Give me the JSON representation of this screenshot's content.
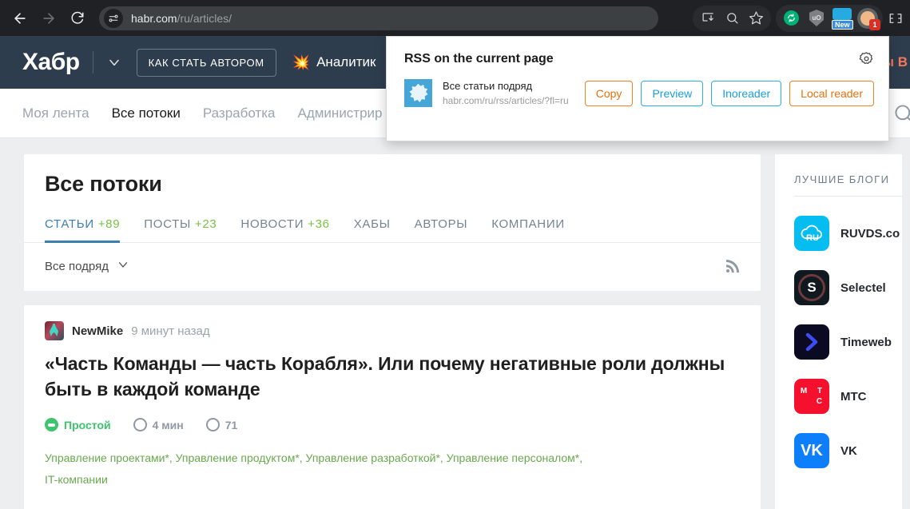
{
  "browser": {
    "back_icon": "back-arrow-icon",
    "forward_icon": "forward-arrow-icon",
    "reload_icon": "reload-icon",
    "site_info_icon": "site-settings-icon",
    "url_host": "habr.com",
    "url_path": "/ru/articles/",
    "toolbar_icons": [
      "install-app-icon",
      "zoom-search-icon",
      "bookmark-star-icon"
    ],
    "extensions": [
      {
        "name": "sync-extension-icon",
        "label": ""
      },
      {
        "name": "ublock-origin-icon",
        "label": "uO"
      },
      {
        "name": "swirl-new-extension-icon",
        "label": "New"
      },
      {
        "name": "profile-avatar-icon",
        "badge": "1"
      }
    ],
    "menu_icon": "chrome-menu-icon"
  },
  "rss_popup": {
    "title": "RSS on the current page",
    "gear_icon": "settings-gear-icon",
    "feed": {
      "icon": "rss-feed-logo-icon",
      "name": "Все статьи подряд",
      "url": "habr.com/ru/rss/articles/?fl=ru"
    },
    "buttons": [
      {
        "label": "Copy",
        "style": "orange"
      },
      {
        "label": "Preview",
        "style": "blue"
      },
      {
        "label": "Inoreader",
        "style": "blue"
      },
      {
        "label": "Local reader",
        "style": "orange"
      }
    ]
  },
  "site_header": {
    "logo": "Хабр",
    "caret_icon": "chevron-down-icon",
    "author_button": "КАК СТАТЬ АВТОРОМ",
    "star_icon": "star-burst-icon",
    "analytics_label": "Аналитик",
    "right_clipped_text": "ы В"
  },
  "site_nav": {
    "items": [
      {
        "label": "Моя лента",
        "active": false
      },
      {
        "label": "Все потоки",
        "active": true
      },
      {
        "label": "Разработка",
        "active": false
      },
      {
        "label": "Администрир",
        "active": false
      }
    ],
    "search_icon": "search-icon"
  },
  "main": {
    "page_title": "Все потоки",
    "tabs": [
      {
        "label": "СТАТЬИ",
        "count": "+89",
        "active": true
      },
      {
        "label": "ПОСТЫ",
        "count": "+23",
        "active": false
      },
      {
        "label": "НОВОСТИ",
        "count": "+36",
        "active": false
      },
      {
        "label": "ХАБЫ",
        "count": "",
        "active": false
      },
      {
        "label": "АВТОРЫ",
        "count": "",
        "active": false
      },
      {
        "label": "КОМПАНИИ",
        "count": "",
        "active": false
      }
    ],
    "filter_label": "Все подряд",
    "filter_caret_icon": "chevron-down-icon",
    "feed_rss_icon": "rss-icon"
  },
  "post": {
    "avatar_icon": "user-avatar-icon",
    "author": "NewMike",
    "time": "9 минут назад",
    "title": "«Часть Команды — часть Корабля». Или почему негативные роли должны быть в каждой команде",
    "complexity_icon": "complexity-gauge-icon",
    "complexity": "Простой",
    "read_time_icon": "clock-icon",
    "read_time": "4 мин",
    "views_icon": "eye-icon",
    "views": "71",
    "tags_line1": "Управление проектами*, Управление продуктом*, Управление разработкой*, Управление персоналом*,",
    "tags_line2": "IT-компании"
  },
  "sidebar": {
    "title": "ЛУЧШИЕ БЛОГИ",
    "blogs": [
      {
        "name": "RUVDS.co",
        "logo": "ruvds-logo-icon",
        "logo_text": "RU"
      },
      {
        "name": "Selectel",
        "logo": "selectel-logo-icon",
        "logo_text": "S"
      },
      {
        "name": "Timeweb",
        "logo": "timeweb-logo-icon",
        "logo_text": "❯"
      },
      {
        "name": "МТС",
        "logo": "mts-logo-icon",
        "logo_text_1": "М Т",
        "logo_text_2": "С"
      },
      {
        "name": "VK",
        "logo": "vk-logo-icon",
        "logo_text": "VK"
      }
    ]
  },
  "colors": {
    "chrome_bg": "#202124",
    "habr_header": "#2e3d4e",
    "accent_blue": "#3c7fb1",
    "accent_green": "#78c144",
    "tag_green": "#6aa84f",
    "orange_btn": "#e8700e",
    "blue_btn": "#1b9ede"
  }
}
